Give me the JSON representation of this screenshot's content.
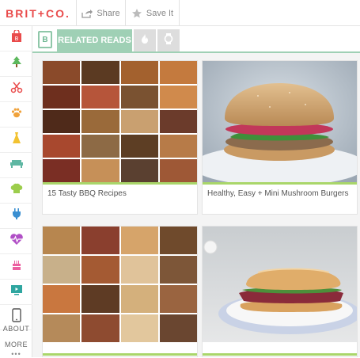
{
  "brand": {
    "logo_text": "BRIT+CO."
  },
  "toolbar": {
    "share_label": "Share",
    "save_label": "Save It"
  },
  "tabs": {
    "b_label": "B",
    "related_label": "RELATED READS"
  },
  "sidebar": {
    "about_label": "ABOUT",
    "more_label": "MORE",
    "dots": "•••"
  },
  "cards": [
    {
      "caption": "15 Tasty BBQ Recipes"
    },
    {
      "caption": "Healthy, Easy + Mini Mushroom Burgers"
    },
    {
      "caption": ""
    },
    {
      "caption": ""
    }
  ],
  "colors": {
    "brand_red": "#e94b4b",
    "accent_green": "#9fd0b5",
    "underline_green": "#a9d66a"
  }
}
